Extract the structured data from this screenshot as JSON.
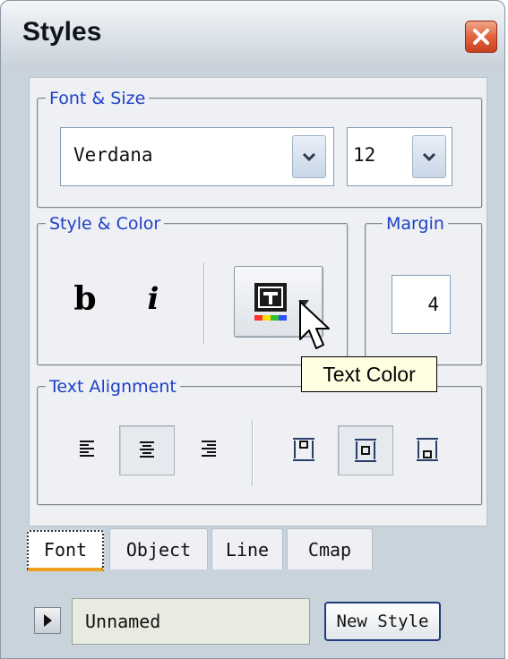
{
  "window": {
    "title": "Styles"
  },
  "font_size": {
    "legend": "Font & Size",
    "font_value": "Verdana",
    "size_value": "12"
  },
  "style_color": {
    "legend": "Style & Color",
    "bold_label": "b",
    "italic_label": "i"
  },
  "margin": {
    "legend": "Margin",
    "value": "4"
  },
  "tooltip": {
    "text": "Text Color"
  },
  "text_alignment": {
    "legend": "Text Alignment"
  },
  "tabs": [
    {
      "label": "Font",
      "active": true
    },
    {
      "label": "Object",
      "active": false
    },
    {
      "label": "Line",
      "active": false
    },
    {
      "label": "Cmap",
      "active": false
    }
  ],
  "footer": {
    "style_name": "Unnamed",
    "new_style_label": "New Style"
  },
  "colors": {
    "legend_text": "#1d40c8",
    "close_button": "#e2643f",
    "active_tab_underline": "#f0a020"
  }
}
